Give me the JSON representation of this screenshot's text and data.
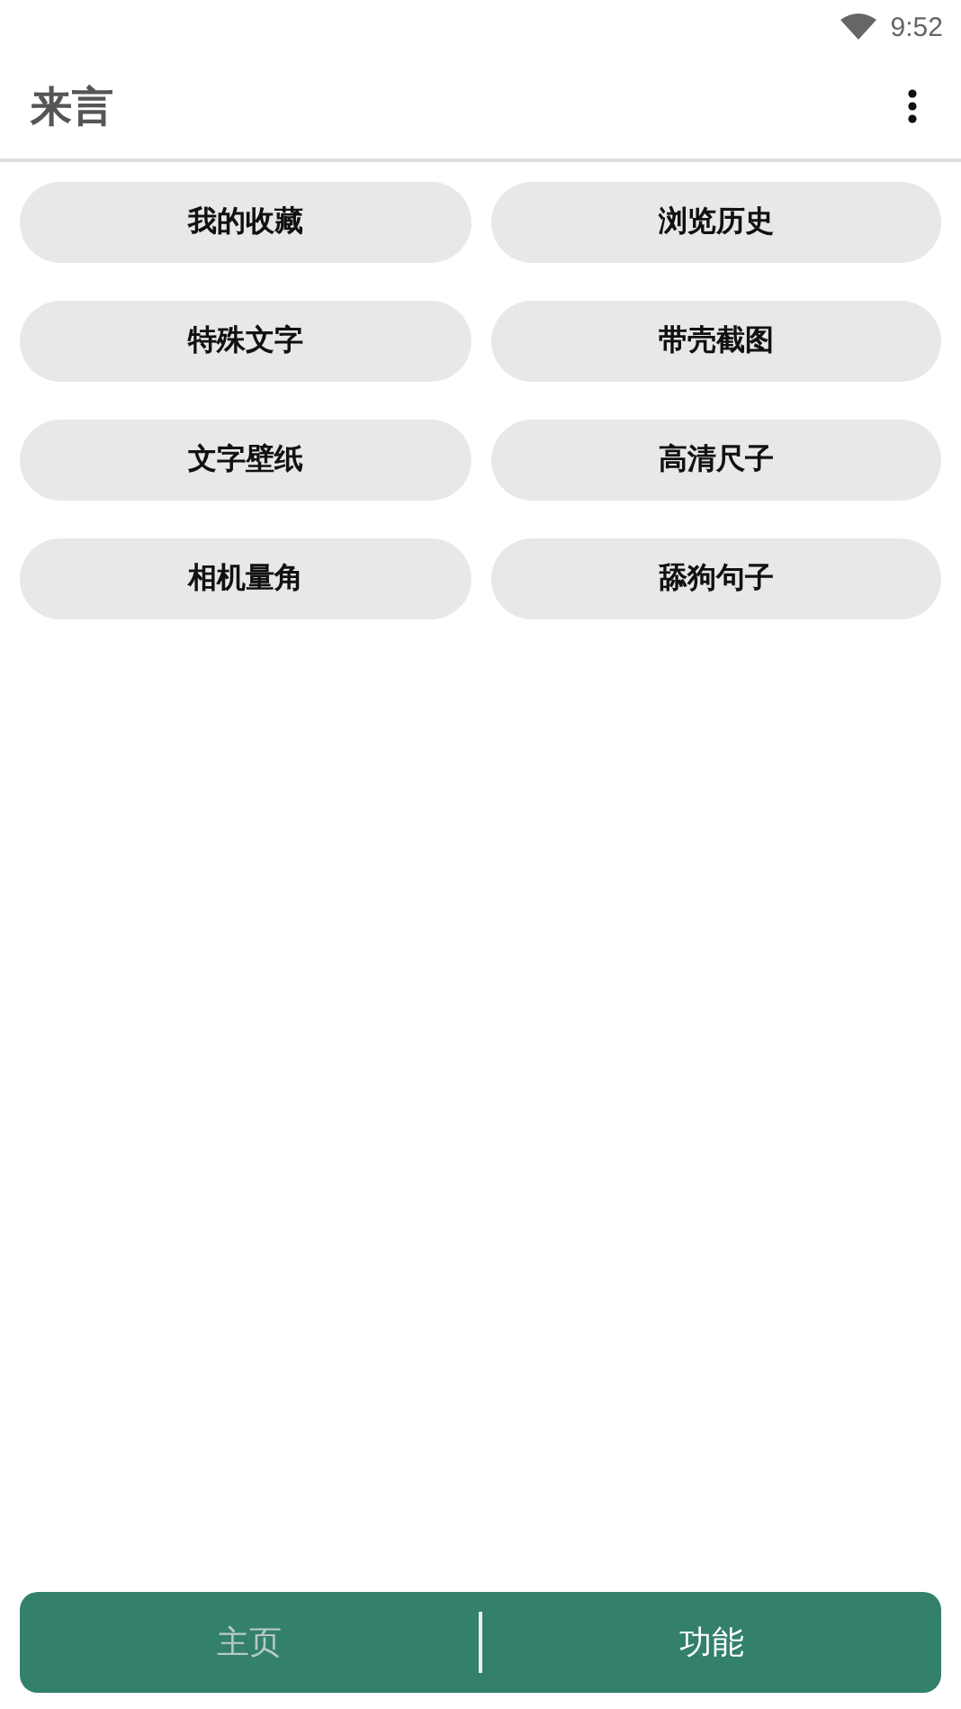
{
  "status_bar": {
    "time": "9:52"
  },
  "app_bar": {
    "title": "来言"
  },
  "buttons": [
    {
      "label": "我的收藏"
    },
    {
      "label": "浏览历史"
    },
    {
      "label": "特殊文字"
    },
    {
      "label": "带壳截图"
    },
    {
      "label": "文字壁纸"
    },
    {
      "label": "高清尺子"
    },
    {
      "label": "相机量角"
    },
    {
      "label": "舔狗句子"
    }
  ],
  "bottom_tabs": [
    {
      "label": "主页",
      "selected": false
    },
    {
      "label": "功能",
      "selected": true
    }
  ]
}
